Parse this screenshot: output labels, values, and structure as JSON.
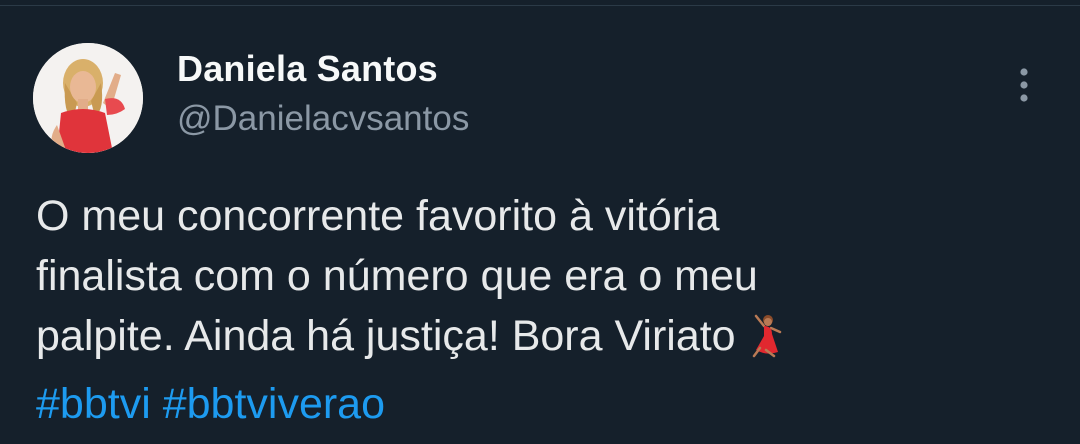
{
  "author": {
    "display_name": "Daniela Santos",
    "handle": "@Danielacvsantos"
  },
  "tweet": {
    "lines": [
      "O meu concorrente favorito à vitória",
      "finalista com o número que era o meu",
      "palpite. Ainda há justiça! Bora Viriato"
    ],
    "emoji": "dancer-emoji",
    "hashtags": [
      "#bbtvi",
      "#bbtviverao"
    ]
  },
  "icons": {
    "more": "more-vertical-icon",
    "avatar": "profile-photo"
  },
  "colors": {
    "background": "#15202b",
    "text": "#e7e9ea",
    "secondary_text": "#8b98a5",
    "hashtag": "#1d9bf0"
  }
}
